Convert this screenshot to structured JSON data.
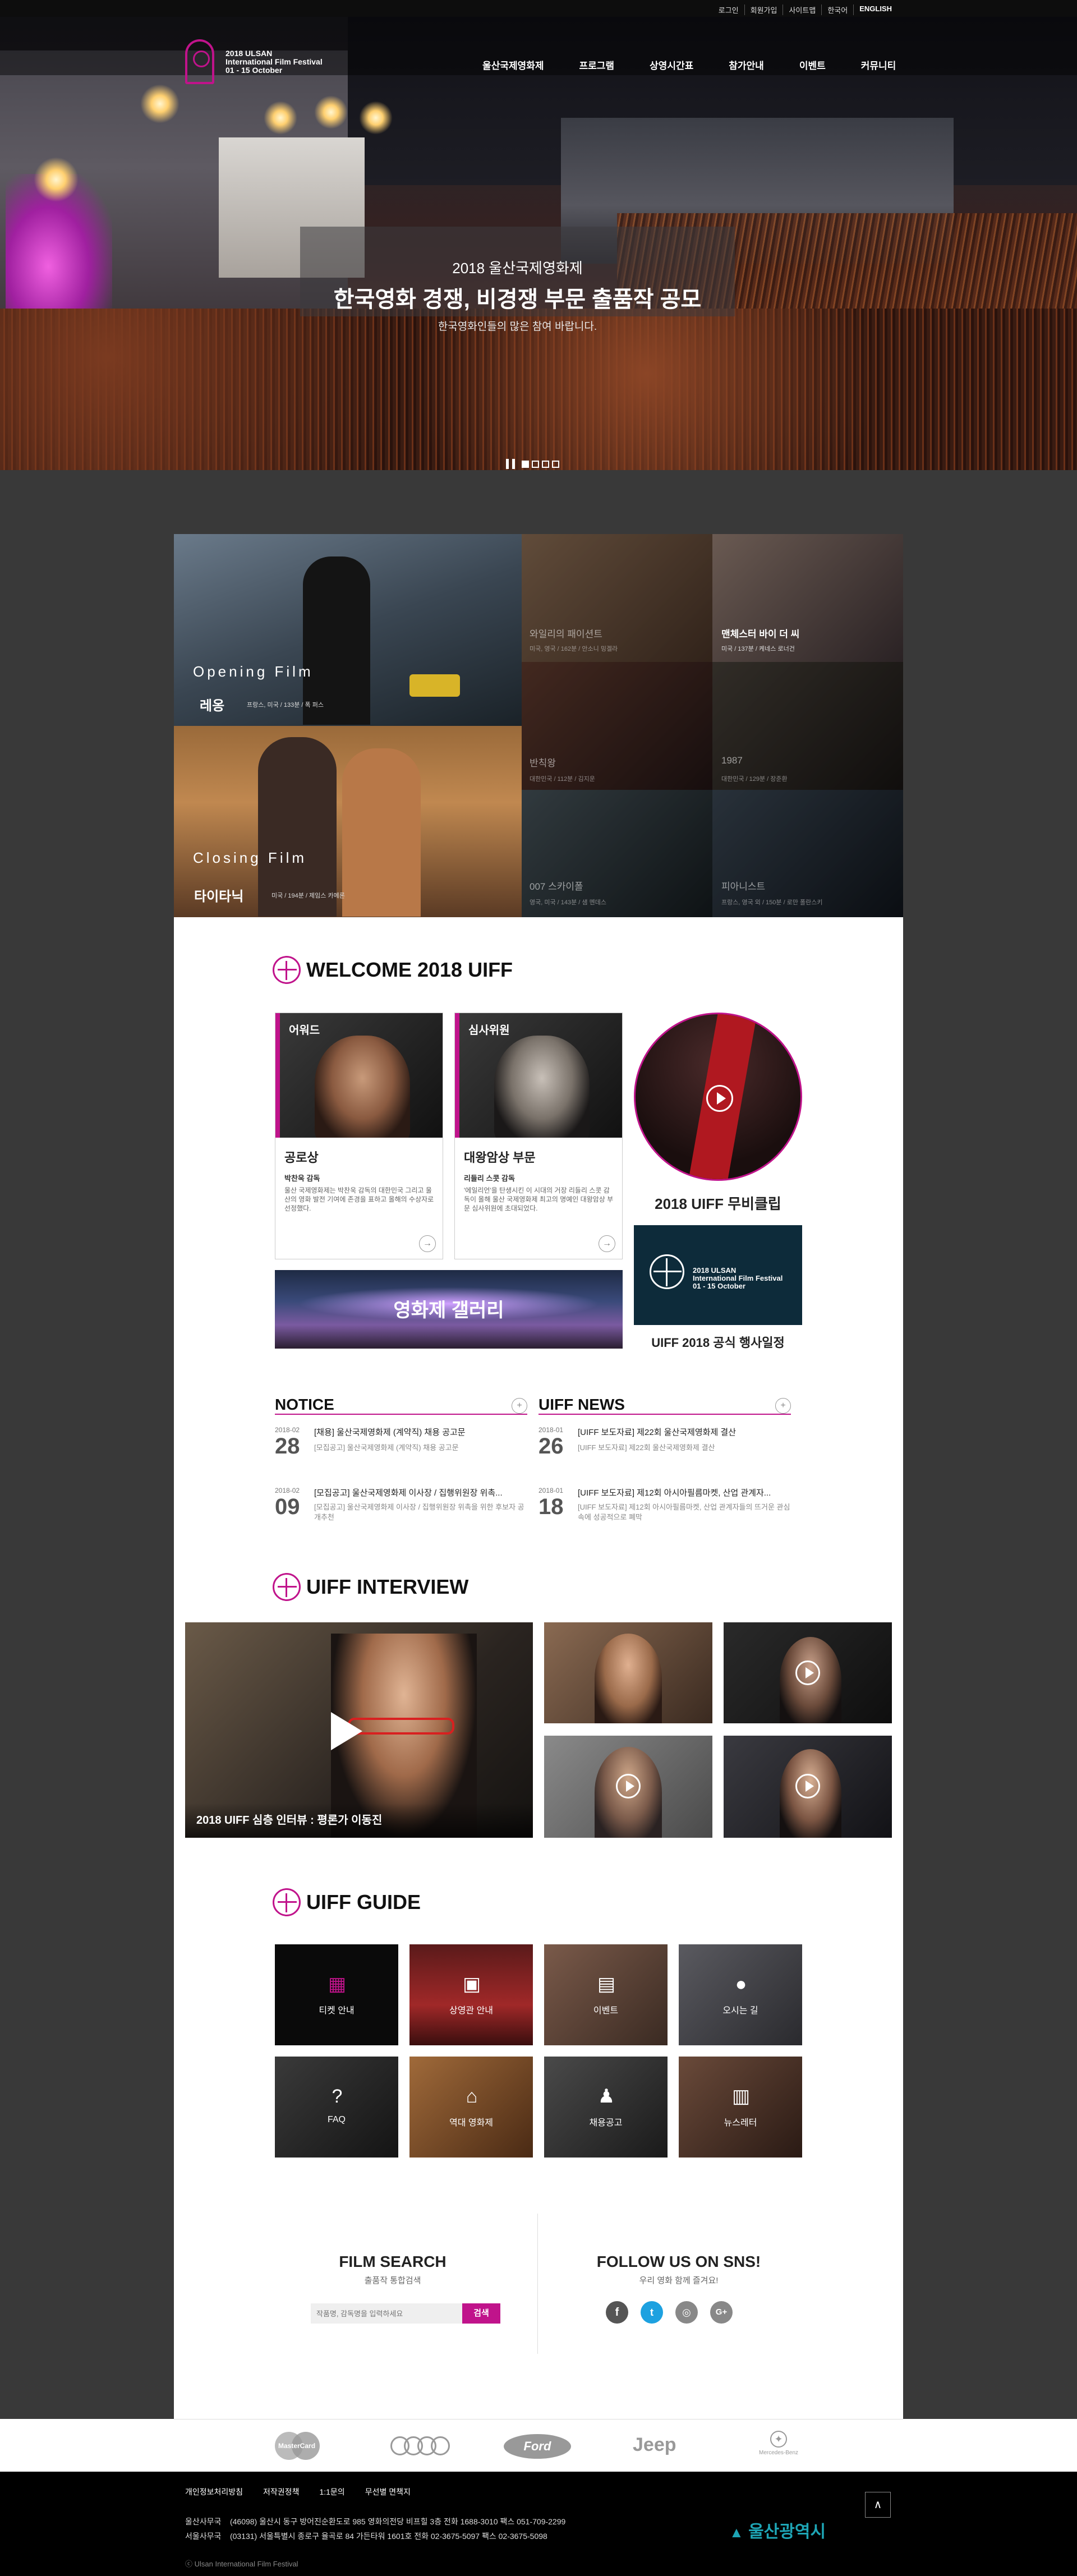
{
  "util_nav": [
    "로그인",
    "회원가입",
    "사이트맵",
    "한국어",
    "ENGLISH"
  ],
  "logo": {
    "line1": "2018 ULSAN",
    "line2": "International Film Festival",
    "line3": "01 - 15 October"
  },
  "gnb": [
    "울산국제영화제",
    "프로그램",
    "상영시간표",
    "참가안내",
    "이벤트",
    "커뮤니티"
  ],
  "hero": {
    "line1": "2018 울산국제영화제",
    "line2": "한국영화 경쟁, 비경쟁 부문 출품작 공모",
    "line3": "한국영화인들의 많은 참여 바랍니다."
  },
  "films": {
    "opening": {
      "category": "Opening Film",
      "title": "레옹",
      "meta": "프랑스, 미국  /  133분  /  폭 퍼스"
    },
    "closing": {
      "category": "Closing Film",
      "title": "타이타닉",
      "meta": "미국  /  194분  /  제임스 카메론"
    },
    "others": [
      {
        "title": "와일리의 패이션트",
        "meta": "미국, 영국  /  162분  /  안소니 밍겔라"
      },
      {
        "title": "맨체스터 바이 더 씨",
        "meta": "미국  /  137분  /  케네스 로너건"
      },
      {
        "title": "반칙왕",
        "meta": "대한민국  /  112분  /  김지운"
      },
      {
        "title": "1987",
        "meta": "대한민국  /  129분  /  장준환"
      },
      {
        "title": "007 스카이폴",
        "meta": "영국, 미국  /  143분  /  샘 멘데스"
      },
      {
        "title": "피아니스트",
        "meta": "프랑스, 영국 외  /  150분  /  로만 폴란스키"
      }
    ]
  },
  "welcome": {
    "title": "WELCOME 2018 UIFF",
    "cards": [
      {
        "label": "어워드",
        "heading": "공로상",
        "who": "박찬욱 감독",
        "text": "울산 국제영화제는 박찬욱 감독의 대한민국 그리고 울산의 영화 발전 기여에 존경을 표하고 올해의 수상자로 선정했다."
      },
      {
        "label": "심사위원",
        "heading": "대왕암상 부문",
        "who": "리들리 스콧 감독",
        "text": "'에일리언'을 탄생시킨 이 시대의 거장 리들리 스콧 감독이 올해 울산 국제영화제 최고의 명예인 대왕암상 부문 심사위원에 초대되었다."
      }
    ],
    "clip_label": "2018 UIFF 무비클립",
    "gallery_label": "영화제 갤러리",
    "schedule_label": "UIFF 2018 공식 행사일정",
    "schedule_logo": {
      "line1": "2018 ULSAN",
      "line2": "International Film Festival",
      "line3": "01 - 15 October"
    }
  },
  "notice": {
    "title": "NOTICE",
    "items": [
      {
        "ym": "2018-02",
        "day": "28",
        "title": "[채용] 울산국제영화제 (계약직) 채용 공고문",
        "desc": "[모집공고] 울산국제영화제 (계약직) 채용 공고문"
      },
      {
        "ym": "2018-02",
        "day": "09",
        "title": "[모집공고] 울산국제영화제 이사장 / 집행위원장 위촉...",
        "desc": "[모집공고] 울산국제영화제 이사장 / 집행위원장 위촉을 위한 후보자 공개추천"
      }
    ]
  },
  "news": {
    "title": "UIFF NEWS",
    "items": [
      {
        "ym": "2018-01",
        "day": "26",
        "title": "[UIFF 보도자료] 제22회 울산국제영화제 결산",
        "desc": "[UIFF 보도자료] 제22회 울산국제영화제 결산"
      },
      {
        "ym": "2018-01",
        "day": "18",
        "title": "[UIFF 보도자료] 제12회 아시아필름마켓, 산업 관계자...",
        "desc": "[UIFF 보도자료] 제12회 아시아필름마켓, 산업 관계자들의 뜨거운 관심 속에 성공적으로 폐막"
      }
    ]
  },
  "interview": {
    "title": "UIFF INTERVIEW",
    "main_caption": "2018 UIFF 심층 인터뷰 : 평론가 이동진"
  },
  "guide": {
    "title": "UIFF GUIDE",
    "items": [
      {
        "label": "티켓 안내",
        "icon": "ticket-icon"
      },
      {
        "label": "상영관 안내",
        "icon": "theater-icon"
      },
      {
        "label": "이벤트",
        "icon": "gift-icon"
      },
      {
        "label": "오시는 길",
        "icon": "location-icon"
      },
      {
        "label": "FAQ",
        "icon": "faq-icon"
      },
      {
        "label": "역대 영화제",
        "icon": "history-icon"
      },
      {
        "label": "채용공고",
        "icon": "recruit-icon"
      },
      {
        "label": "뉴스레터",
        "icon": "newsletter-icon"
      }
    ]
  },
  "film_search": {
    "title": "FILM SEARCH",
    "sub": "출품작 통합검색",
    "placeholder": "작품명, 감독명을 입력하세요",
    "button": "검색"
  },
  "sns": {
    "title": "FOLLOW US ON SNS!",
    "sub": "우리 영화 함께 즐겨요!",
    "icons": [
      "facebook-icon",
      "twitter-icon",
      "instagram-icon",
      "google-plus-icon"
    ]
  },
  "sponsors": [
    "MasterCard",
    "Audi",
    "Ford",
    "Jeep",
    "Mercedes-Benz"
  ],
  "footer": {
    "links": [
      "개인정보처리방침",
      "저작권정책",
      "1:1문의",
      "무선별 면책지"
    ],
    "addr1_label": "울산사무국",
    "addr1": "(46098) 울산시 동구 방어진순환도로 985 영화의전당 비프힐 3층    전화 1688-3010    팩스 051-709-2299",
    "addr2_label": "서울사무국",
    "addr2": "(03131) 서울특별시 종로구 율곡로 84 가든타워 1601호    전화 02-3675-5097    팩스 02-3675-5098",
    "copy": "ⓒ Ulsan International Film Festival",
    "top": "∧",
    "city": "울산광역시"
  },
  "colors": {
    "accent": "#c0138b",
    "dark": "#393939"
  }
}
